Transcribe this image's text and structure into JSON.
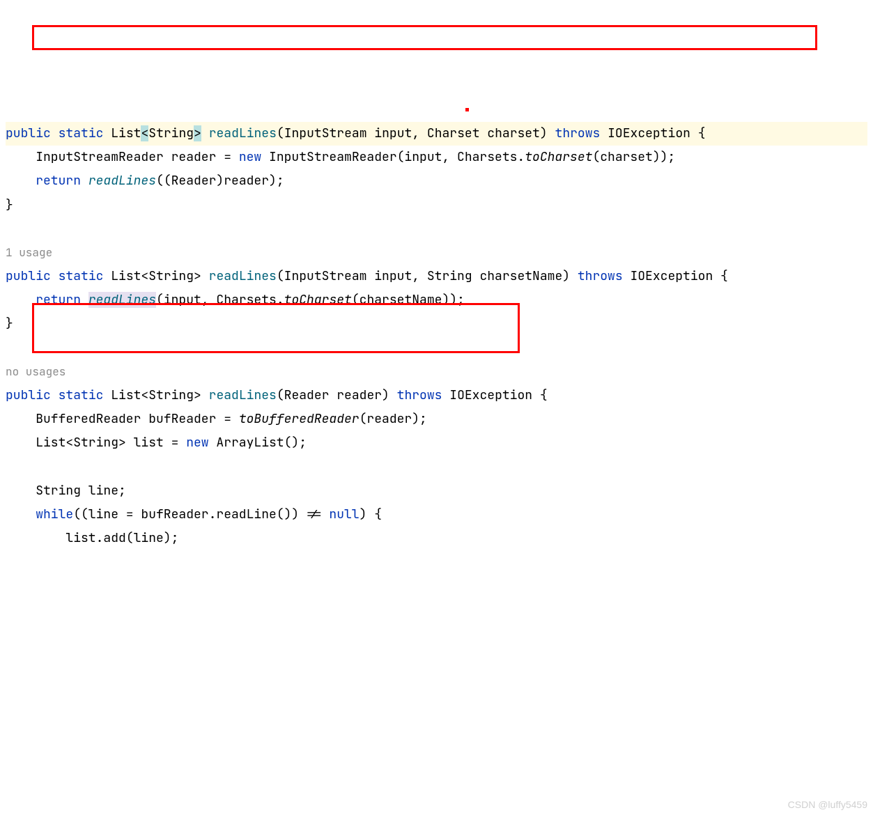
{
  "code": {
    "line1": {
      "pre": "public static List",
      "lt": "<",
      "string": "String",
      "gt": ">",
      "space": " ",
      "method": "readLines",
      "params": "(InputStream input, Charset charset) ",
      "throws": "throws",
      "exc": " IOException {"
    },
    "line2": {
      "indent": "    ",
      "t1": "InputStreamReader reader = ",
      "new": "new",
      "t2": " InputStreamReader(input, Charsets.",
      "tocharset": "toCharset",
      "t3": "(charset));"
    },
    "line3": {
      "indent": "    ",
      "ret": "return",
      "space": " ",
      "method": "readLines",
      "rest": "((Reader)reader);"
    },
    "line4": "}",
    "usage1": "1 usage",
    "line6": {
      "prefix": "public static",
      "type": " List<String> ",
      "method": "readLines",
      "params": "(InputStream input, String charsetName) ",
      "throws": "throws",
      "exc": " IOException {"
    },
    "line7": {
      "indent": "    ",
      "ret": "return",
      "space": " ",
      "method": "readLines",
      "t1": "(input, Charsets.",
      "tocharset": "toCharset",
      "t2": "(charsetName));"
    },
    "line8": "}",
    "usage2": "no usages",
    "line10": {
      "prefix": "public static",
      "type": " List<String> ",
      "method": "readLines",
      "params": "(Reader reader) ",
      "throws": "throws",
      "exc": " IOException {"
    },
    "line11": {
      "indent": "    ",
      "t1": "BufferedReader bufReader = ",
      "method": "toBufferedReader",
      "t2": "(reader);"
    },
    "line12": {
      "indent": "    ",
      "t1": "List<String> list = ",
      "new": "new",
      "t2": " ArrayList();"
    },
    "line14": {
      "indent": "    ",
      "t1": "String line;"
    },
    "line15": {
      "indent": "    ",
      "while": "while",
      "t1": "((line = bufReader.readLine()) != ",
      "null": "null",
      "t2": ") {"
    },
    "line16": {
      "indent": "        ",
      "t1": "list.add(line);"
    }
  },
  "watermark": "CSDN @luffy5459"
}
